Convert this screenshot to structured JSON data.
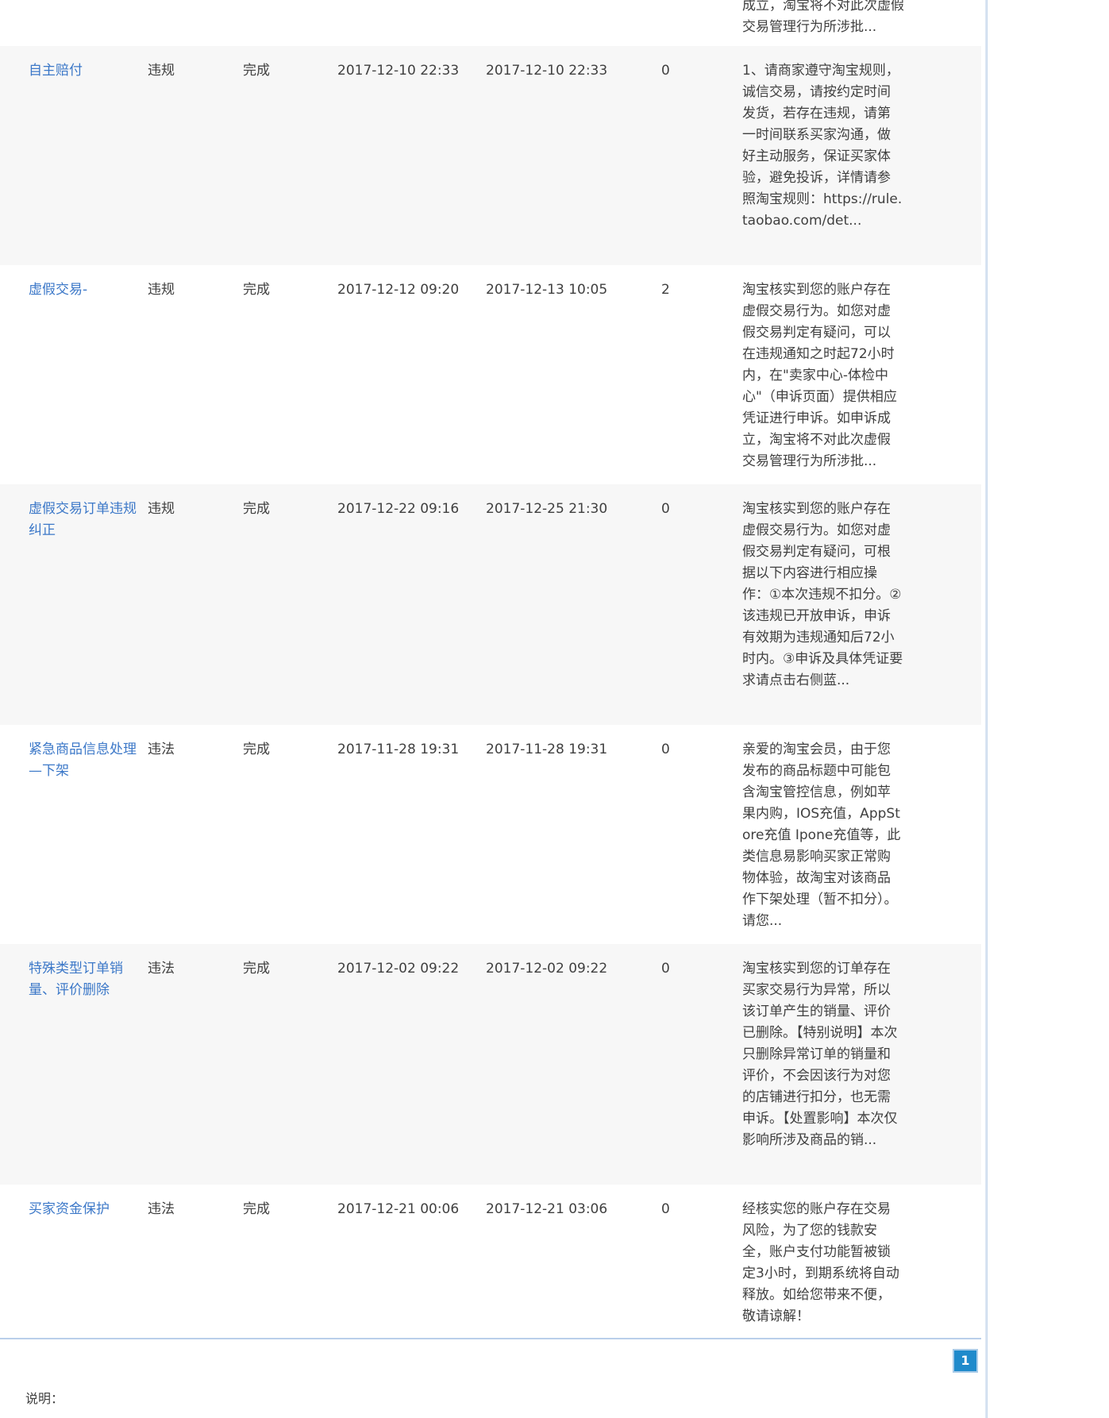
{
  "top_fragment": "成立，淘宝将不对此次虚假交易管理行为所涉批...",
  "rows": [
    {
      "name": "自主赔付",
      "type": "违规",
      "status": "完成",
      "start": "2017-12-10 22:33",
      "end": "2017-12-10 22:33",
      "score": "0",
      "desc": "1、请商家遵守淘宝规则，诚信交易，请按约定时间发货，若存在违规，请第一时间联系买家沟通，做好主动服务，保证买家体验，避免投诉，详情请参照淘宝规则：https://rule.taobao.com/det..."
    },
    {
      "name": "虚假交易-",
      "type": "违规",
      "status": "完成",
      "start": "2017-12-12 09:20",
      "end": "2017-12-13 10:05",
      "score": "2",
      "desc": "淘宝核实到您的账户存在虚假交易行为。如您对虚假交易判定有疑问，可以在违规通知之时起72小时内，在\"卖家中心-体检中心\"（申诉页面）提供相应凭证进行申诉。如申诉成立，淘宝将不对此次虚假交易管理行为所涉批..."
    },
    {
      "name": "虚假交易订单违规纠正",
      "type": "违规",
      "status": "完成",
      "start": "2017-12-22 09:16",
      "end": "2017-12-25 21:30",
      "score": "0",
      "desc": "淘宝核实到您的账户存在虚假交易行为。如您对虚假交易判定有疑问，可根据以下内容进行相应操作：①本次违规不扣分。②该违规已开放申诉，申诉有效期为违规通知后72小时内。③申诉及具体凭证要求请点击右侧蓝..."
    },
    {
      "name": "紧急商品信息处理—下架",
      "type": "违法",
      "status": "完成",
      "start": "2017-11-28 19:31",
      "end": "2017-11-28 19:31",
      "score": "0",
      "desc": "亲爱的淘宝会员，由于您发布的商品标题中可能包含淘宝管控信息，例如苹果内购，IOS充值，AppStore充值 Ipone充值等，此类信息易影响买家正常购物体验，故淘宝对该商品作下架处理（暂不扣分）。请您..."
    },
    {
      "name": "特殊类型订单销量、评价删除",
      "type": "违法",
      "status": "完成",
      "start": "2017-12-02 09:22",
      "end": "2017-12-02 09:22",
      "score": "0",
      "desc": "淘宝核实到您的订单存在买家交易行为异常，所以该订单产生的销量、评价已删除。【特别说明】本次只删除异常订单的销量和评价，不会因该行为对您的店铺进行扣分，也无需申诉。【处置影响】本次仅影响所涉及商品的销..."
    },
    {
      "name": "买家资金保护",
      "type": "违法",
      "status": "完成",
      "start": "2017-12-21 00:06",
      "end": "2017-12-21 03:06",
      "score": "0",
      "desc": "经核实您的账户存在交易风险，为了您的钱款安全，账户支付功能暂被锁定3小时，到期系统将自动释放。如给您带来不便，敬请谅解！"
    }
  ],
  "pager": {
    "current": "1"
  },
  "note": "说明："
}
